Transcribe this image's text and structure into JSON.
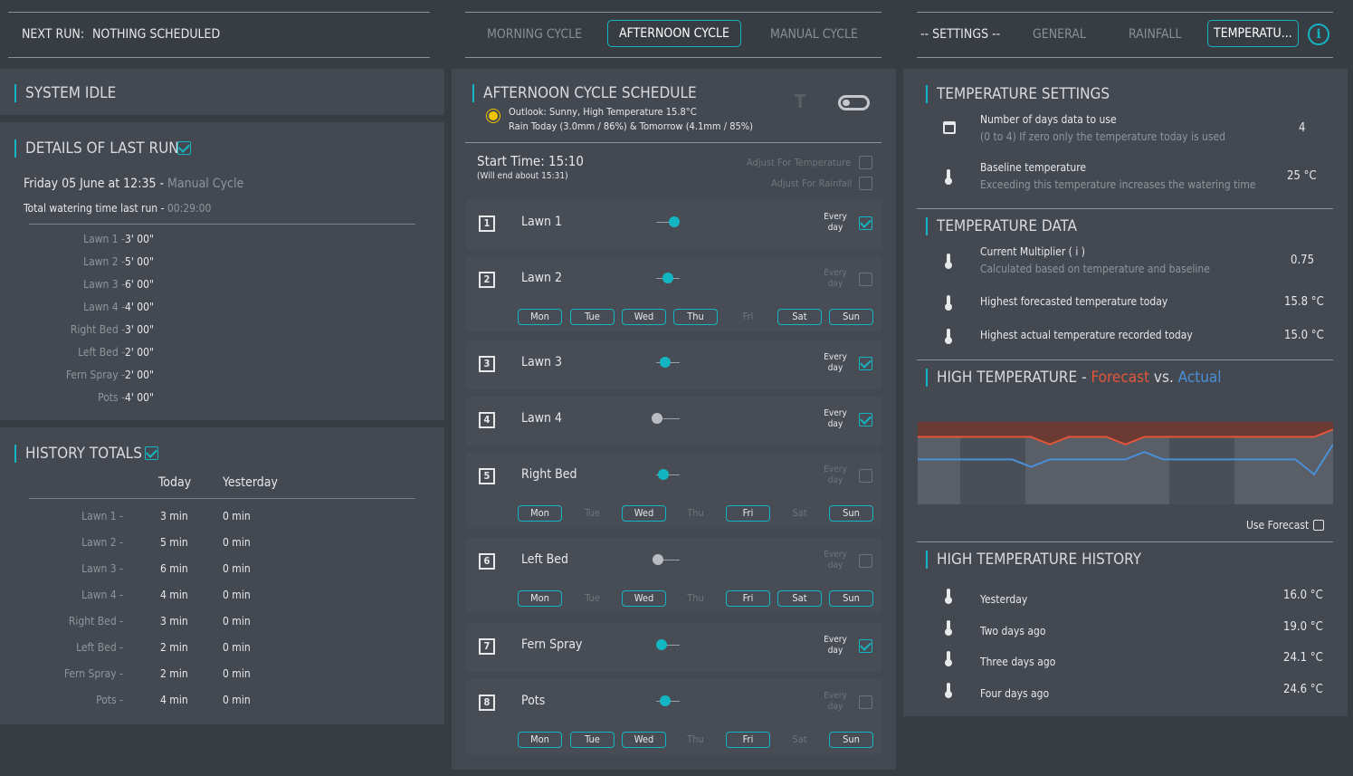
{
  "header": {
    "next_run_label": "NEXT RUN:",
    "next_run_value": "NOTHING SCHEDULED",
    "cycle_tabs": [
      "MORNING CYCLE",
      "AFTERNOON CYCLE",
      "MANUAL CYCLE"
    ],
    "settings_tabs": [
      "-- SETTINGS --",
      "GENERAL",
      "RAINFALL",
      "TEMPERATU..."
    ],
    "active_cycle_tab": "AFTERNOON CYCLE",
    "active_settings_tab": "TEMPERATU..."
  },
  "left": {
    "system_status": "SYSTEM IDLE",
    "details_title": "DETAILS OF LAST RUN",
    "last_run_date": "Friday 05 June at 12:35 - ",
    "last_run_cycle": "Manual Cycle",
    "total_label": "Total watering time last run - ",
    "total_value": "00:29:00",
    "last_run_items": [
      {
        "name": "Lawn 1 - ",
        "time": "3' 00\""
      },
      {
        "name": "Lawn 2 - ",
        "time": "5' 00\""
      },
      {
        "name": "Lawn 3 - ",
        "time": "6' 00\""
      },
      {
        "name": "Lawn 4 - ",
        "time": "4' 00\""
      },
      {
        "name": "Right Bed - ",
        "time": "3' 00\""
      },
      {
        "name": "Left Bed - ",
        "time": "2' 00\""
      },
      {
        "name": "Fern Spray - ",
        "time": "2' 00\""
      },
      {
        "name": "Pots - ",
        "time": "4' 00\""
      }
    ],
    "history_title": "HISTORY TOTALS",
    "history_col_today": "Today",
    "history_col_yesterday": "Yesterday",
    "history_rows": [
      {
        "name": "Lawn 1 -",
        "today": "3 min",
        "yesterday": "0 min"
      },
      {
        "name": "Lawn 2 -",
        "today": "5 min",
        "yesterday": "0 min"
      },
      {
        "name": "Lawn 3 -",
        "today": "6 min",
        "yesterday": "0 min"
      },
      {
        "name": "Lawn 4 -",
        "today": "4 min",
        "yesterday": "0 min"
      },
      {
        "name": "Right Bed -",
        "today": "3 min",
        "yesterday": "0 min"
      },
      {
        "name": "Left Bed -",
        "today": "2 min",
        "yesterday": "0 min"
      },
      {
        "name": "Fern Spray -",
        "today": "2 min",
        "yesterday": "0 min"
      },
      {
        "name": "Pots -",
        "today": "4 min",
        "yesterday": "0 min"
      }
    ]
  },
  "middle": {
    "title": "AFTERNOON CYCLE SCHEDULE",
    "outlook_line1": "Outlook: Sunny, High Temperature 15.8°C",
    "outlook_line2": "Rain Today (3.0mm / 86%) & Tomorrow (4.1mm / 85%)",
    "start_time": "Start Time: 15:10",
    "end_time": "(Will end about 15:31)",
    "adjust_temp": "Adjust For Temperature",
    "adjust_rain": "Adjust For Rainfall",
    "every_day_label": "Every day",
    "zones": [
      {
        "num": "1",
        "name": "Lawn 1",
        "every_day": true,
        "dot_grey": false,
        "days": []
      },
      {
        "num": "2",
        "name": "Lawn 2",
        "every_day": false,
        "dot_grey": false,
        "days": [
          {
            "label": "Mon",
            "on": true
          },
          {
            "label": "Tue",
            "on": true
          },
          {
            "label": "Wed",
            "on": true
          },
          {
            "label": "Thu",
            "on": true
          },
          {
            "label": "Fri",
            "on": false
          },
          {
            "label": "Sat",
            "on": true
          },
          {
            "label": "Sun",
            "on": true
          }
        ]
      },
      {
        "num": "3",
        "name": "Lawn 3",
        "every_day": true,
        "dot_grey": false,
        "days": []
      },
      {
        "num": "4",
        "name": "Lawn 4",
        "every_day": true,
        "dot_grey": true,
        "days": []
      },
      {
        "num": "5",
        "name": "Right Bed",
        "every_day": false,
        "dot_grey": false,
        "days": [
          {
            "label": "Mon",
            "on": true
          },
          {
            "label": "Tue",
            "on": false
          },
          {
            "label": "Wed",
            "on": true
          },
          {
            "label": "Thu",
            "on": false
          },
          {
            "label": "Fri",
            "on": true
          },
          {
            "label": "Sat",
            "on": false
          },
          {
            "label": "Sun",
            "on": true
          }
        ]
      },
      {
        "num": "6",
        "name": "Left Bed",
        "every_day": false,
        "dot_grey": true,
        "days": [
          {
            "label": "Mon",
            "on": true
          },
          {
            "label": "Tue",
            "on": false
          },
          {
            "label": "Wed",
            "on": true
          },
          {
            "label": "Thu",
            "on": false
          },
          {
            "label": "Fri",
            "on": true
          },
          {
            "label": "Sat",
            "on": true
          },
          {
            "label": "Sun",
            "on": true
          }
        ]
      },
      {
        "num": "7",
        "name": "Fern Spray",
        "every_day": true,
        "dot_grey": false,
        "days": []
      },
      {
        "num": "8",
        "name": "Pots",
        "every_day": false,
        "dot_grey": false,
        "days": [
          {
            "label": "Mon",
            "on": true
          },
          {
            "label": "Tue",
            "on": true
          },
          {
            "label": "Wed",
            "on": true
          },
          {
            "label": "Thu",
            "on": false
          },
          {
            "label": "Fri",
            "on": true
          },
          {
            "label": "Sat",
            "on": false
          },
          {
            "label": "Sun",
            "on": true
          }
        ]
      }
    ]
  },
  "right": {
    "temp_settings_title": "TEMPERATURE SETTINGS",
    "days_label": "Number of days data to use",
    "days_sub": "(0 to 4) If zero only the temperature today is used",
    "days_value": "4",
    "baseline_label": "Baseline temperature",
    "baseline_sub": "Exceeding this temperature increases the watering time",
    "baseline_value": "25 °C",
    "temp_data_title": "TEMPERATURE DATA",
    "multiplier_label": "Current Multiplier ( i )",
    "multiplier_sub": "Calculated based on temperature and baseline",
    "multiplier_value": "0.75",
    "highest_forecast_label": "Highest forecasted temperature today",
    "highest_forecast_value": "15.8 °C",
    "highest_actual_label": "Highest actual temperature recorded today",
    "highest_actual_value": "15.0 °C",
    "chart_title_prefix": "HIGH TEMPERATURE - ",
    "chart_title_forecast": "Forecast",
    "chart_title_vs": " vs. ",
    "chart_title_actual": "Actual",
    "use_forecast": "Use Forecast",
    "history_title": "HIGH TEMPERATURE HISTORY",
    "history": [
      {
        "label": "Yesterday",
        "value": "16.0 °C"
      },
      {
        "label": "Two days ago",
        "value": "19.0 °C"
      },
      {
        "label": "Three days ago",
        "value": "24.1 °C"
      },
      {
        "label": "Four days ago",
        "value": "24.6 °C"
      }
    ]
  },
  "colors": {
    "accent": "#14b5c2",
    "forecast": "#e2553a",
    "actual": "#4a8fd8",
    "background": "#383c43",
    "panel": "#444951"
  },
  "chart_data": {
    "type": "line",
    "series": [
      {
        "name": "Forecast",
        "values": [
          15.9,
          15.9,
          15.9,
          15.9,
          15.9,
          15.9,
          15.9,
          15.8,
          15.9,
          15.9,
          15.9,
          15.8,
          15.9,
          15.9,
          15.9,
          15.9,
          15.9,
          15.9,
          15.9,
          15.9,
          15.9,
          15.9,
          16.0
        ]
      },
      {
        "name": "Actual",
        "values": [
          15.6,
          15.6,
          15.6,
          15.6,
          15.6,
          15.6,
          15.5,
          15.6,
          15.6,
          15.6,
          15.6,
          15.6,
          15.7,
          15.6,
          15.6,
          15.6,
          15.6,
          15.6,
          15.6,
          15.6,
          15.6,
          15.4,
          15.8
        ]
      }
    ],
    "ylim": [
      15,
      16.1
    ],
    "grid": false
  }
}
